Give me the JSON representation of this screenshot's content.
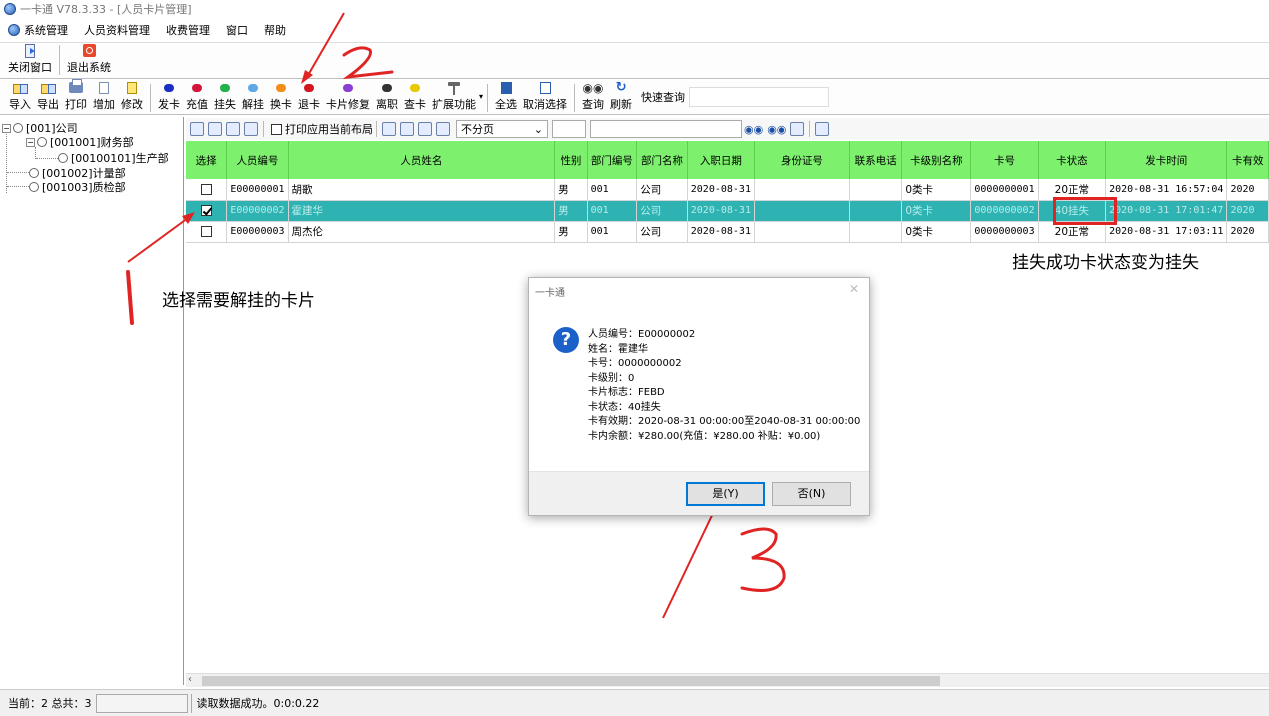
{
  "window": {
    "title": "一卡通 V78.3.33 - [人员卡片管理]"
  },
  "menu": [
    "系统管理",
    "人员资料管理",
    "收费管理",
    "窗口",
    "帮助"
  ],
  "toolbar1": {
    "close_window": "关闭窗口",
    "exit_system": "退出系统"
  },
  "toolbar2": {
    "buttons": [
      "导入",
      "导出",
      "打印",
      "增加",
      "修改"
    ],
    "card_buttons": [
      {
        "label": "发卡",
        "color": "#1b2fc4"
      },
      {
        "label": "充值",
        "color": "#d3163a"
      },
      {
        "label": "挂失",
        "color": "#22b14c"
      },
      {
        "label": "解挂",
        "color": "#5fa7e8"
      },
      {
        "label": "换卡",
        "color": "#f28c1a"
      },
      {
        "label": "退卡",
        "color": "#d4161f"
      },
      {
        "label": "卡片修复",
        "color": "#8b3fd3"
      },
      {
        "label": "离职",
        "color": "#333333"
      },
      {
        "label": "查卡",
        "color": "#e8c800"
      }
    ],
    "extend": "扩展功能",
    "select_all": "全选",
    "unselect": "取消选择",
    "query": "查询",
    "refresh": "刷新",
    "quick_query": "快速查询"
  },
  "tree": {
    "nodes": [
      {
        "label": "[001]公司"
      },
      {
        "label": "[001001]财务部"
      },
      {
        "label": "[00100101]生产部"
      },
      {
        "label": "[001002]计量部"
      },
      {
        "label": "[001003]质检部"
      }
    ]
  },
  "grid_toolbar": {
    "print_layout": "打印应用当前布局",
    "paging": "不分页"
  },
  "grid": {
    "columns": [
      "选择",
      "人员编号",
      "人员姓名",
      "性别",
      "部门编号",
      "部门名称",
      "入职日期",
      "身份证号",
      "联系电话",
      "卡级别名称",
      "卡号",
      "卡状态",
      "发卡时间",
      "卡有效"
    ],
    "rows": [
      {
        "id": "E00000001",
        "name": "胡歌",
        "gender": "男",
        "dept_no": "001",
        "dept_name": "公司",
        "join": "2020-08-31",
        "idcard": "",
        "phone": "",
        "level": "0类卡",
        "card": "0000000001",
        "status": "20正常",
        "issue": "2020-08-31 16:57:04",
        "valid": "2020"
      },
      {
        "id": "E00000002",
        "name": "霍建华",
        "gender": "男",
        "dept_no": "001",
        "dept_name": "公司",
        "join": "2020-08-31",
        "idcard": "",
        "phone": "",
        "level": "0类卡",
        "card": "0000000002",
        "status": "40挂失",
        "issue": "2020-08-31 17:01:47",
        "valid": "2020"
      },
      {
        "id": "E00000003",
        "name": "周杰伦",
        "gender": "男",
        "dept_no": "001",
        "dept_name": "公司",
        "join": "2020-08-31",
        "idcard": "",
        "phone": "",
        "level": "0类卡",
        "card": "0000000003",
        "status": "20正常",
        "issue": "2020-08-31 17:03:11",
        "valid": "2020"
      }
    ]
  },
  "annotations": {
    "step1": "选择需要解挂的卡片",
    "status_note": "挂失成功卡状态变为挂失"
  },
  "dialog": {
    "title": "一卡通",
    "lines": [
      "人员编号：E00000002",
      "姓名：霍建华",
      "卡号：0000000002",
      "卡级别：0",
      "卡片标志：FEBD",
      "卡状态：40挂失",
      "卡有效期：2020-08-31 00:00:00至2040-08-31 00:00:00",
      "卡内余额：¥280.00(充值：¥280.00  补贴：¥0.00)"
    ],
    "yes": "是(Y)",
    "no": "否(N)"
  },
  "statusbar": {
    "current": "当前：2  总共：3",
    "message": "读取数据成功。0:0:0.22"
  }
}
